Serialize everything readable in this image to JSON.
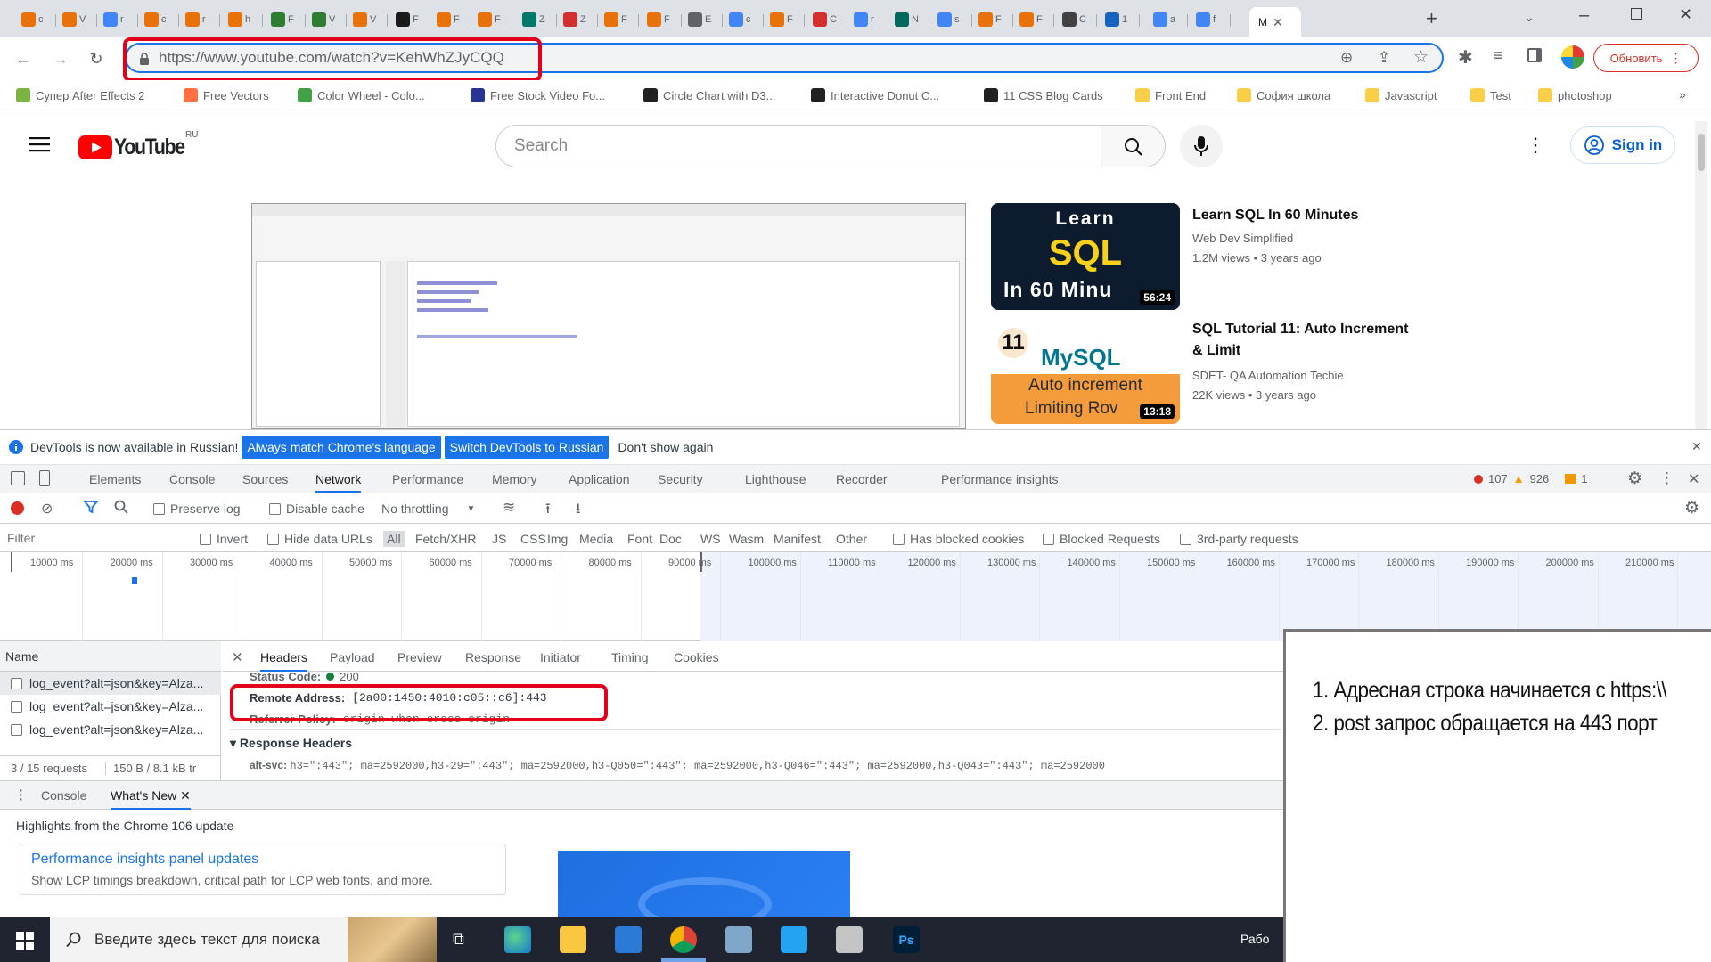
{
  "browser": {
    "tabs": [
      {
        "label": "c",
        "color": "#e8710a"
      },
      {
        "label": "V",
        "color": "#e8710a"
      },
      {
        "label": "r",
        "color": "#4285f4"
      },
      {
        "label": "c",
        "color": "#e8710a"
      },
      {
        "label": "r",
        "color": "#e8710a"
      },
      {
        "label": "h",
        "color": "#e8710a"
      },
      {
        "label": "F",
        "color": "#2e7d32"
      },
      {
        "label": "V",
        "color": "#2e7d32"
      },
      {
        "label": "V",
        "color": "#e8710a"
      },
      {
        "label": "F",
        "color": "#1a1a1a"
      },
      {
        "label": "F",
        "color": "#e8710a"
      },
      {
        "label": "F",
        "color": "#e8710a"
      },
      {
        "label": "Z",
        "color": "#00796b"
      },
      {
        "label": "Z",
        "color": "#d32f2f"
      },
      {
        "label": "F",
        "color": "#e8710a"
      },
      {
        "label": "F",
        "color": "#e8710a"
      },
      {
        "label": "E",
        "color": "#5f6368"
      },
      {
        "label": "c",
        "color": "#4285f4"
      },
      {
        "label": "F",
        "color": "#e8710a"
      },
      {
        "label": "C",
        "color": "#d32f2f"
      },
      {
        "label": "r",
        "color": "#4285f4"
      },
      {
        "label": "N",
        "color": "#00695c"
      },
      {
        "label": "s",
        "color": "#4285f4"
      },
      {
        "label": "F",
        "color": "#e8710a"
      },
      {
        "label": "F",
        "color": "#e8710a"
      },
      {
        "label": "C",
        "color": "#424242"
      },
      {
        "label": "1",
        "color": "#1565c0"
      },
      {
        "label": "a",
        "color": "#4285f4"
      },
      {
        "label": "f",
        "color": "#4285f4"
      }
    ],
    "active_tab": {
      "label": "M"
    },
    "url": "https://www.youtube.com/watch?v=KehWhZJyCQQ",
    "update_label": "Обновить",
    "bookmarks": [
      {
        "label": "Супер After Effects 2",
        "color": "#7cb342"
      },
      {
        "label": "Free Vectors",
        "color": "#ff7043"
      },
      {
        "label": "Color Wheel - Colo...",
        "color": "#43a047"
      },
      {
        "label": "Free Stock Video Fo...",
        "color": "#283593"
      },
      {
        "label": "Circle Chart with D3...",
        "color": "#212121"
      },
      {
        "label": "Interactive Donut C...",
        "color": "#212121"
      },
      {
        "label": "11 CSS Blog Cards",
        "color": "#212121"
      },
      {
        "label": "Front End",
        "color": "#f9cf4a"
      },
      {
        "label": "София школа",
        "color": "#f9cf4a"
      },
      {
        "label": "Javascript",
        "color": "#f9cf4a"
      },
      {
        "label": "Test",
        "color": "#f9cf4a"
      },
      {
        "label": "photoshop",
        "color": "#f9cf4a"
      }
    ]
  },
  "youtube": {
    "logo_text": "YouTube",
    "region": "RU",
    "search_placeholder": "Search",
    "sign_in": "Sign in",
    "recommendations": [
      {
        "title_lines": [
          "Learn SQL In 60 Minutes"
        ],
        "channel": "Web Dev Simplified",
        "meta": "1.2M views • 3 years ago",
        "duration": "56:24",
        "thumb_lines": [
          "Learn",
          "SQL",
          "In 60 Minu"
        ]
      },
      {
        "title_lines": [
          "SQL Tutorial 11: Auto Increment",
          "& Limit"
        ],
        "channel": "SDET- QA Automation Techie",
        "meta": "22K views • 3 years ago",
        "duration": "13:18",
        "thumb_lines": [
          "11",
          "MySQL",
          "Auto increment",
          "Limiting Rov"
        ]
      }
    ]
  },
  "devtools": {
    "info_text": "DevTools is now available in Russian!",
    "btn_match": "Always match Chrome's language",
    "btn_switch": "Switch DevTools to Russian",
    "btn_dont": "Don't show again",
    "tabs": [
      "Elements",
      "Console",
      "Sources",
      "Network",
      "Performance",
      "Memory",
      "Application",
      "Security",
      "Lighthouse",
      "Recorder",
      "Performance insights"
    ],
    "active_tab": "Network",
    "errors": "107",
    "warnings": "926",
    "issues": "1",
    "controls": {
      "preserve_log": "Preserve log",
      "disable_cache": "Disable cache",
      "throttling": "No throttling"
    },
    "filter": {
      "placeholder": "Filter",
      "invert": "Invert",
      "hide_data_urls": "Hide data URLs",
      "types": [
        "All",
        "Fetch/XHR",
        "JS",
        "CSS",
        "Img",
        "Media",
        "Font",
        "Doc",
        "WS",
        "Wasm",
        "Manifest",
        "Other"
      ],
      "has_blocked": "Has blocked cookies",
      "blocked_requests": "Blocked Requests",
      "third_party": "3rd-party requests"
    },
    "timeline_ticks": [
      "10000 ms",
      "20000 ms",
      "30000 ms",
      "40000 ms",
      "50000 ms",
      "60000 ms",
      "70000 ms",
      "80000 ms",
      "90000 ms",
      "100000 ms",
      "110000 ms",
      "120000 ms",
      "130000 ms",
      "140000 ms",
      "150000 ms",
      "160000 ms",
      "170000 ms",
      "180000 ms",
      "190000 ms",
      "200000 ms",
      "210000 ms"
    ],
    "name_header": "Name",
    "requests": [
      "log_event?alt=json&key=Alza...",
      "log_event?alt=json&key=Alza...",
      "log_event?alt=json&key=Alza..."
    ],
    "summary": "3 / 15 requests",
    "transferred": "150 B / 8.1 kB tr",
    "detail_tabs": [
      "Headers",
      "Payload",
      "Preview",
      "Response",
      "Initiator",
      "Timing",
      "Cookies"
    ],
    "status_code_label": "Status Code:",
    "status_code_value": "200",
    "remote_label": "Remote Address:",
    "remote_value": "[2a00:1450:4010:c05::c6]:443",
    "referrer_label": "Referrer Policy:",
    "referrer_value": "origin-when-cross-origin",
    "response_headers": "Response Headers",
    "alt_svc_label": "alt-svc:",
    "alt_svc_value": "h3=\":443\"; ma=2592000,h3-29=\":443\"; ma=2592000,h3-Q050=\":443\"; ma=2592000,h3-Q046=\":443\"; ma=2592000,h3-Q043=\":443\"; ma=2592000",
    "drawer_tabs": [
      "Console",
      "What's New"
    ],
    "highlights": "Highlights from the Chrome 106 update",
    "card_title": "Performance insights panel updates",
    "card_text": "Show LCP timings breakdown, critical path for LCP web fonts, and more."
  },
  "annotation": {
    "lines": [
      "1. Адресная строка начинается с https:\\\\",
      "2. post запрос обращается на 443 порт"
    ]
  },
  "taskbar": {
    "search_placeholder": "Введите здесь текст для поиска",
    "right_text": "Рабо"
  }
}
